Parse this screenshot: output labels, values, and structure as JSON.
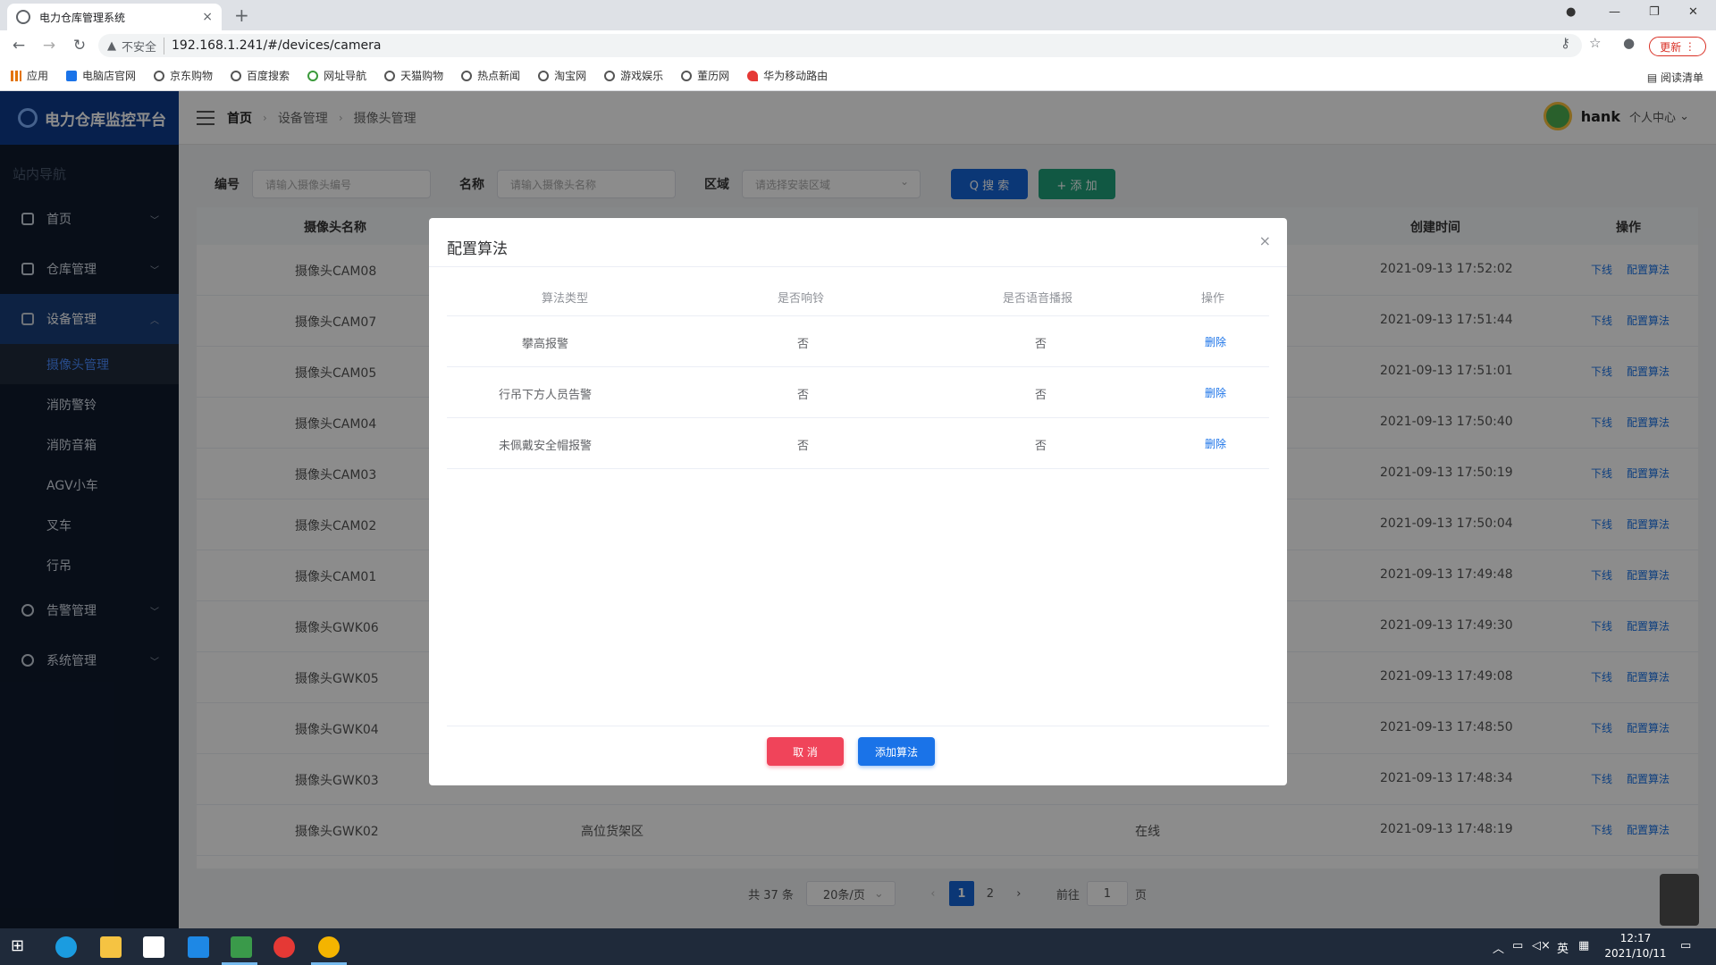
{
  "browser": {
    "tab_title": "电力仓库管理系统",
    "tab_close": "×",
    "new_tab": "+",
    "not_secure": "不安全",
    "url": "192.168.1.241/#/devices/camera",
    "update_label": "更新",
    "bookmarks": [
      "应用",
      "电脑店官网",
      "京东购物",
      "百度搜索",
      "网址导航",
      "天猫购物",
      "热点新闻",
      "淘宝网",
      "游戏娱乐",
      "董历网",
      "华为移动路由"
    ],
    "reading_list": "阅读清单"
  },
  "sidebar": {
    "logo": "电力仓库监控平台",
    "caption": "站内导航",
    "items": [
      {
        "label": "首页",
        "icon": "home-icon"
      },
      {
        "label": "仓库管理",
        "icon": "warehouse-icon"
      },
      {
        "label": "设备管理",
        "icon": "monitor-icon"
      }
    ],
    "sub_items": [
      "摄像头管理",
      "消防警铃",
      "消防音箱",
      "AGV小车",
      "叉车",
      "行吊"
    ],
    "bottom_items": [
      {
        "label": "告警管理",
        "icon": "alert-icon"
      },
      {
        "label": "系统管理",
        "icon": "gear-icon"
      }
    ]
  },
  "topbar": {
    "breadcrumb": [
      "首页",
      "设备管理",
      "摄像头管理"
    ],
    "user_name": "hank",
    "user_center": "个人中心"
  },
  "filter": {
    "code_label": "编号",
    "code_placeholder": "请输入摄像头编号",
    "name_label": "名称",
    "name_placeholder": "请输入摄像头名称",
    "area_label": "区域",
    "area_placeholder": "请选择安装区域",
    "search_button": "Q 搜 索",
    "add_button": "+ 添 加"
  },
  "table": {
    "headers": {
      "name": "摄像头名称",
      "created": "创建时间",
      "ops": "操作"
    },
    "rows": [
      {
        "name": "摄像头CAM08",
        "area": "",
        "status": "",
        "created": "2021-09-13 17:52:02"
      },
      {
        "name": "摄像头CAM07",
        "area": "",
        "status": "",
        "created": "2021-09-13 17:51:44"
      },
      {
        "name": "摄像头CAM05",
        "area": "",
        "status": "",
        "created": "2021-09-13 17:51:01"
      },
      {
        "name": "摄像头CAM04",
        "area": "",
        "status": "",
        "created": "2021-09-13 17:50:40"
      },
      {
        "name": "摄像头CAM03",
        "area": "",
        "status": "",
        "created": "2021-09-13 17:50:19"
      },
      {
        "name": "摄像头CAM02",
        "area": "",
        "status": "",
        "created": "2021-09-13 17:50:04"
      },
      {
        "name": "摄像头CAM01",
        "area": "",
        "status": "",
        "created": "2021-09-13 17:49:48"
      },
      {
        "name": "摄像头GWK06",
        "area": "",
        "status": "",
        "created": "2021-09-13 17:49:30"
      },
      {
        "name": "摄像头GWK05",
        "area": "",
        "status": "",
        "created": "2021-09-13 17:49:08"
      },
      {
        "name": "摄像头GWK04",
        "area": "",
        "status": "",
        "created": "2021-09-13 17:48:50"
      },
      {
        "name": "摄像头GWK03",
        "area": "",
        "status": "",
        "created": "2021-09-13 17:48:34"
      },
      {
        "name": "摄像头GWK02",
        "area": "高位货架区",
        "status": "在线",
        "created": "2021-09-13 17:48:19"
      }
    ],
    "op_offline": "下线",
    "op_config": "配置算法"
  },
  "pagination": {
    "total": "共 37 条",
    "page_size": "20条/页",
    "pages": [
      "1",
      "2"
    ],
    "current_page": 1,
    "goto_label": "前往",
    "goto_value": "1",
    "page_suffix": "页"
  },
  "dialog": {
    "title": "配置算法",
    "close": "×",
    "headers": [
      "算法类型",
      "是否响铃",
      "是否语音播报",
      "操作"
    ],
    "rows": [
      {
        "type": "攀高报警",
        "ring": "否",
        "voice": "否",
        "op": "删除"
      },
      {
        "type": "行吊下方人员告警",
        "ring": "否",
        "voice": "否",
        "op": "删除"
      },
      {
        "type": "未佩戴安全帽报警",
        "ring": "否",
        "voice": "否",
        "op": "删除"
      }
    ],
    "cancel_button": "取 消",
    "add_button": "添加算法"
  },
  "taskbar": {
    "ime": "英",
    "time": "12:17",
    "date": "2021/10/11"
  }
}
